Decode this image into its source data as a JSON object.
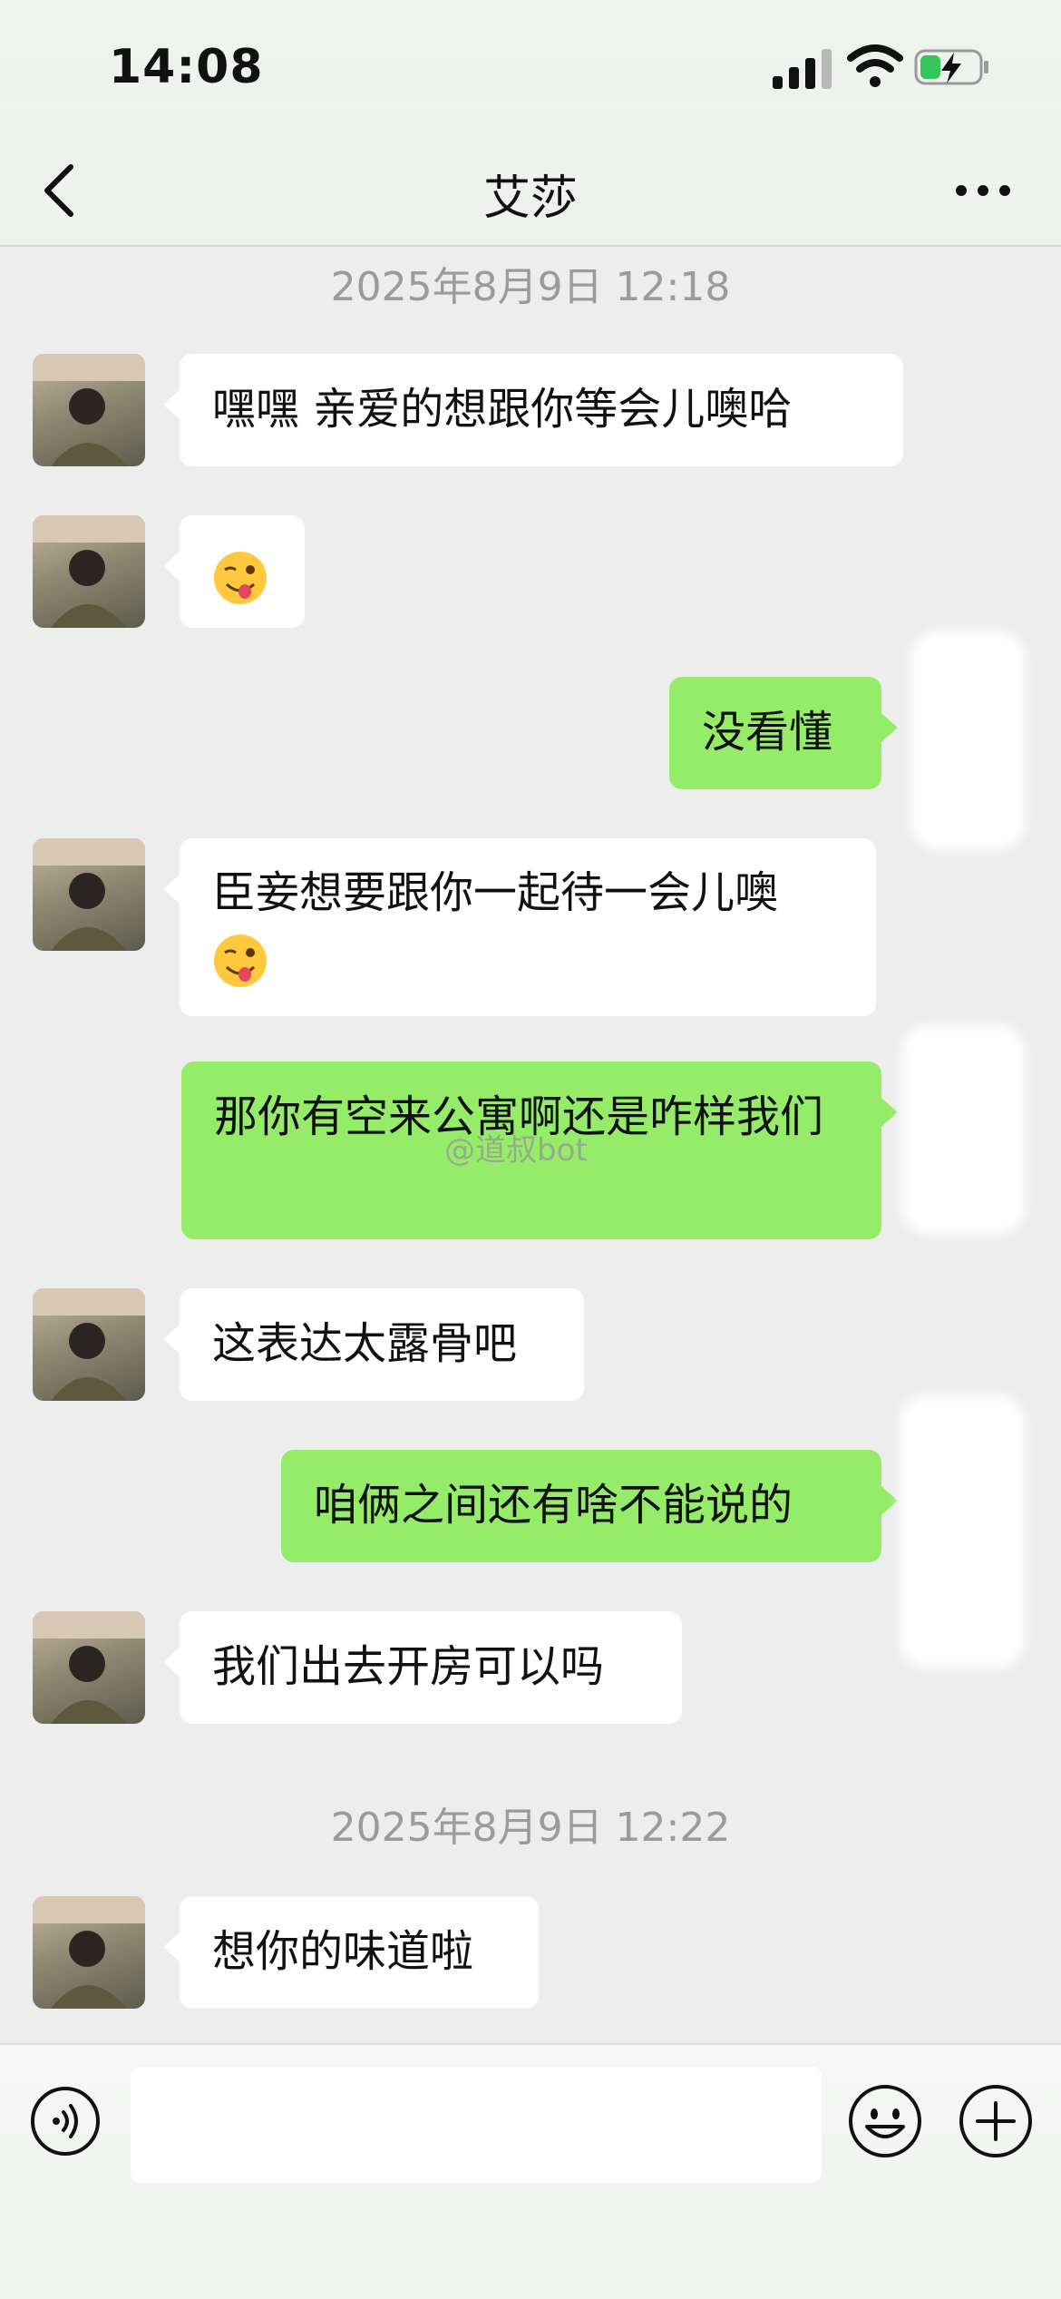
{
  "status_bar": {
    "time": "14:08",
    "signal_icon": "signal-icon",
    "wifi_icon": "wifi-icon",
    "battery_icon": "battery-charging-icon"
  },
  "nav": {
    "title": "艾莎",
    "back_icon": "chevron-left-icon",
    "more_icon": "more-icon"
  },
  "timestamps": [
    "2025年8月9日 12:18",
    "2025年8月9日 12:22"
  ],
  "messages": [
    {
      "from": "contact",
      "text": "嘿嘿  亲爱的想跟你等会儿噢哈"
    },
    {
      "from": "contact",
      "emoji": "wink-tongue-emoji"
    },
    {
      "from": "me",
      "text": "没看懂"
    },
    {
      "from": "contact",
      "text": "臣妾想要跟你一起待一会儿噢",
      "emoji": "wink-tongue-emoji"
    },
    {
      "from": "me",
      "text": "那你有空来公寓啊还是咋样我们"
    },
    {
      "from": "contact",
      "text": "这表达太露骨吧"
    },
    {
      "from": "me",
      "text": "咱俩之间还有啥不能说的"
    },
    {
      "from": "contact",
      "text": "我们出去开房可以吗"
    },
    {
      "from": "contact",
      "text": "想你的味道啦"
    }
  ],
  "watermark": "@道叔bot",
  "input_bar": {
    "voice_icon": "voice-icon",
    "value": "",
    "emoji_icon": "smiley-icon",
    "add_icon": "plus-circle-icon"
  },
  "colors": {
    "outgoing_bubble": "#95ec69",
    "incoming_bubble": "#ffffff",
    "background": "#ededed"
  }
}
